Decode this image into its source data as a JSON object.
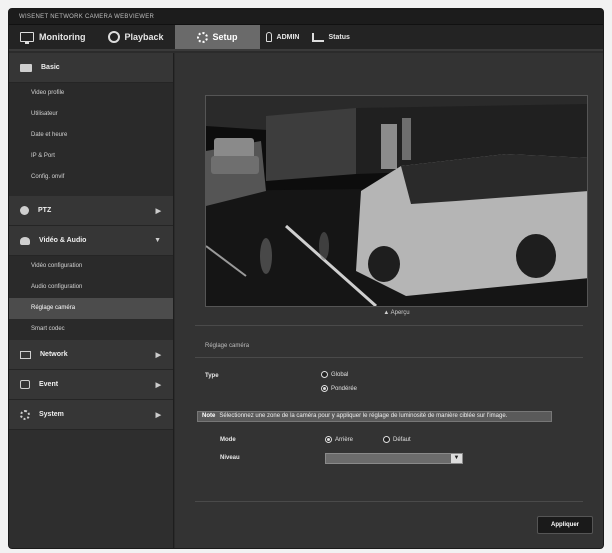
{
  "window": {
    "title": "WISENET NETWORK CAMERA WEBVIEWER"
  },
  "nav": {
    "monitoring": "Monitoring",
    "playback": "Playback",
    "setup": "Setup",
    "admin": "ADMIN",
    "status": "Status"
  },
  "sidebar": {
    "basic": {
      "label": "Basic",
      "items": [
        "Video profile",
        "Utilisateur",
        "Date et heure",
        "IP & Port",
        "Config. onvif"
      ]
    },
    "ptz": {
      "label": "PTZ"
    },
    "video_audio": {
      "label": "Vidéo & Audio",
      "items": [
        "Vidéo configuration",
        "Audio configuration",
        "Réglage caméra",
        "Smart codec"
      ]
    },
    "network": {
      "label": "Network"
    },
    "event": {
      "label": "Event"
    },
    "system": {
      "label": "System"
    }
  },
  "main": {
    "preview_label": "▲ Aperçu",
    "section_title": "Réglage caméra",
    "type": {
      "label": "Type",
      "options": [
        "Global",
        "Pondérée"
      ],
      "selected": "Pondérée"
    },
    "notice": {
      "label": "Note",
      "text": "Sélectionnez une zone de la caméra pour y appliquer le réglage de luminosité de manière ciblée sur l'image."
    },
    "mode": {
      "label": "Mode",
      "options": [
        "Arrière",
        "Défaut"
      ],
      "selected": "Arrière"
    },
    "niveau": {
      "label": "Niveau",
      "value": ""
    },
    "apply_label": "Appliquer"
  },
  "colors": {
    "background": "#2b2b2b",
    "active_tab": "#6a6a6a",
    "selected_item": "#4c4c4c"
  }
}
